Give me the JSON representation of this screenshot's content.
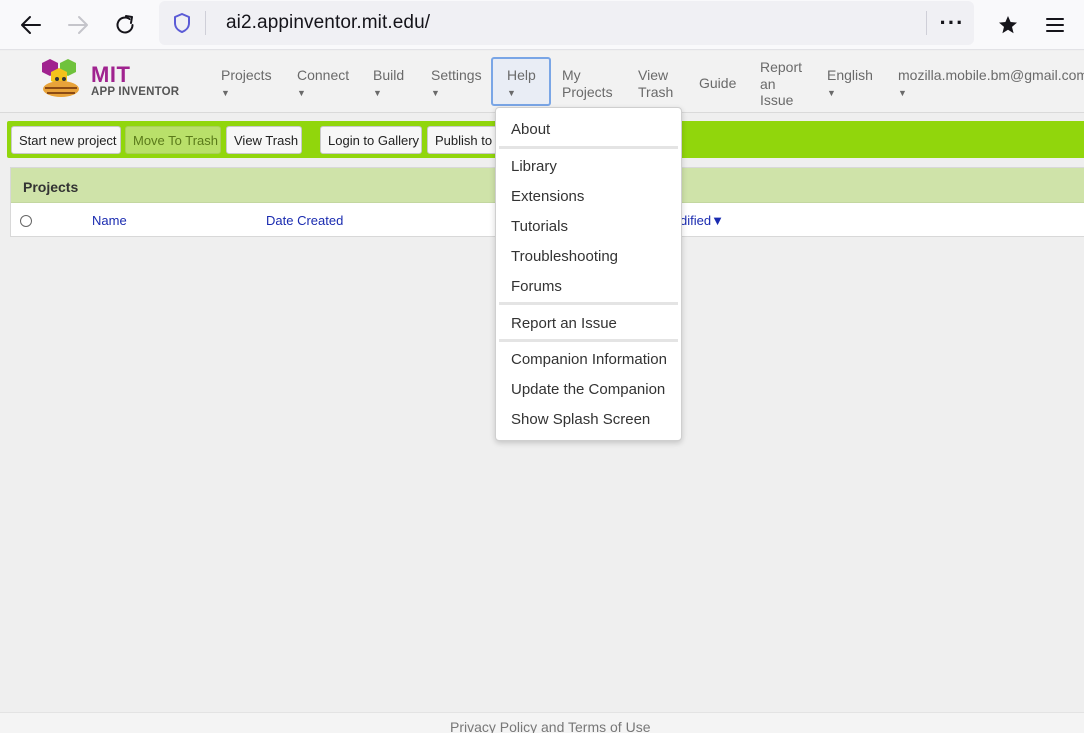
{
  "browser": {
    "url": "ai2.appinventor.mit.edu/",
    "more_label": "···"
  },
  "app": {
    "logo": {
      "title": "MIT",
      "subtitle": "APP INVENTOR"
    },
    "nav": {
      "projects": "Projects",
      "connect": "Connect",
      "build": "Build",
      "settings": "Settings",
      "help": "Help",
      "my_projects_1": "My",
      "my_projects_2": "Projects",
      "view_trash_1": "View",
      "view_trash_2": "Trash",
      "guide": "Guide",
      "report_1": "Report",
      "report_2": "an",
      "report_3": "Issue",
      "language": "English",
      "account": "mozilla.mobile.bm@gmail.com",
      "caret": "▼"
    },
    "toolbar": {
      "start_new_project": "Start new project",
      "move_to_trash": "Move To Trash",
      "view_trash": "View Trash",
      "login_gallery": "Login to Gallery",
      "publish_gallery": "Publish to Gallery"
    },
    "projects": {
      "title": "Projects",
      "col_name": "Name",
      "col_date_created": "Date Created",
      "col_date_modified_visible": "dified▼"
    },
    "help_menu": {
      "items": [
        "About",
        "Library",
        "Extensions",
        "Tutorials",
        "Troubleshooting",
        "Forums",
        "Report an Issue",
        "Companion Information",
        "Update the Companion",
        "Show Splash Screen"
      ]
    },
    "footer": {
      "link": "Privacy Policy and Terms of Use"
    }
  },
  "colors": {
    "toolbar_green": "#91d60c",
    "projects_header": "#cfe3a9",
    "link_blue": "#1a2bb0",
    "logo_purple": "#a0238f"
  }
}
